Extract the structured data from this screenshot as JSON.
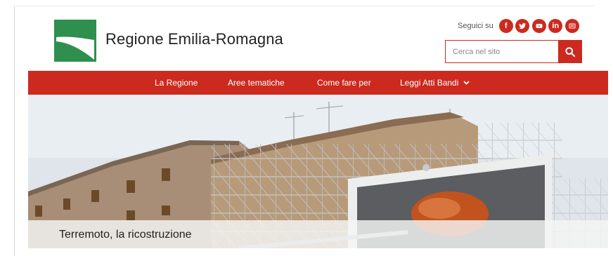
{
  "brand": {
    "title": "Regione Emilia-Romagna",
    "accent": "#cc2a1f",
    "logo_green": "#2f8f4e"
  },
  "social": {
    "label": "Seguici su",
    "items": [
      {
        "name": "facebook",
        "glyph": "f"
      },
      {
        "name": "twitter",
        "glyph": ""
      },
      {
        "name": "youtube",
        "glyph": ""
      },
      {
        "name": "linkedin",
        "glyph": "in"
      },
      {
        "name": "newsletter",
        "glyph": ""
      }
    ]
  },
  "search": {
    "placeholder": "Cerca nel sito"
  },
  "nav": {
    "items": [
      {
        "label": "La Regione"
      },
      {
        "label": "Aree tematiche"
      },
      {
        "label": "Come fare per"
      },
      {
        "label": "Leggi Atti Bandi"
      }
    ]
  },
  "hero": {
    "caption": "Terremoto, la ricostruzione"
  }
}
